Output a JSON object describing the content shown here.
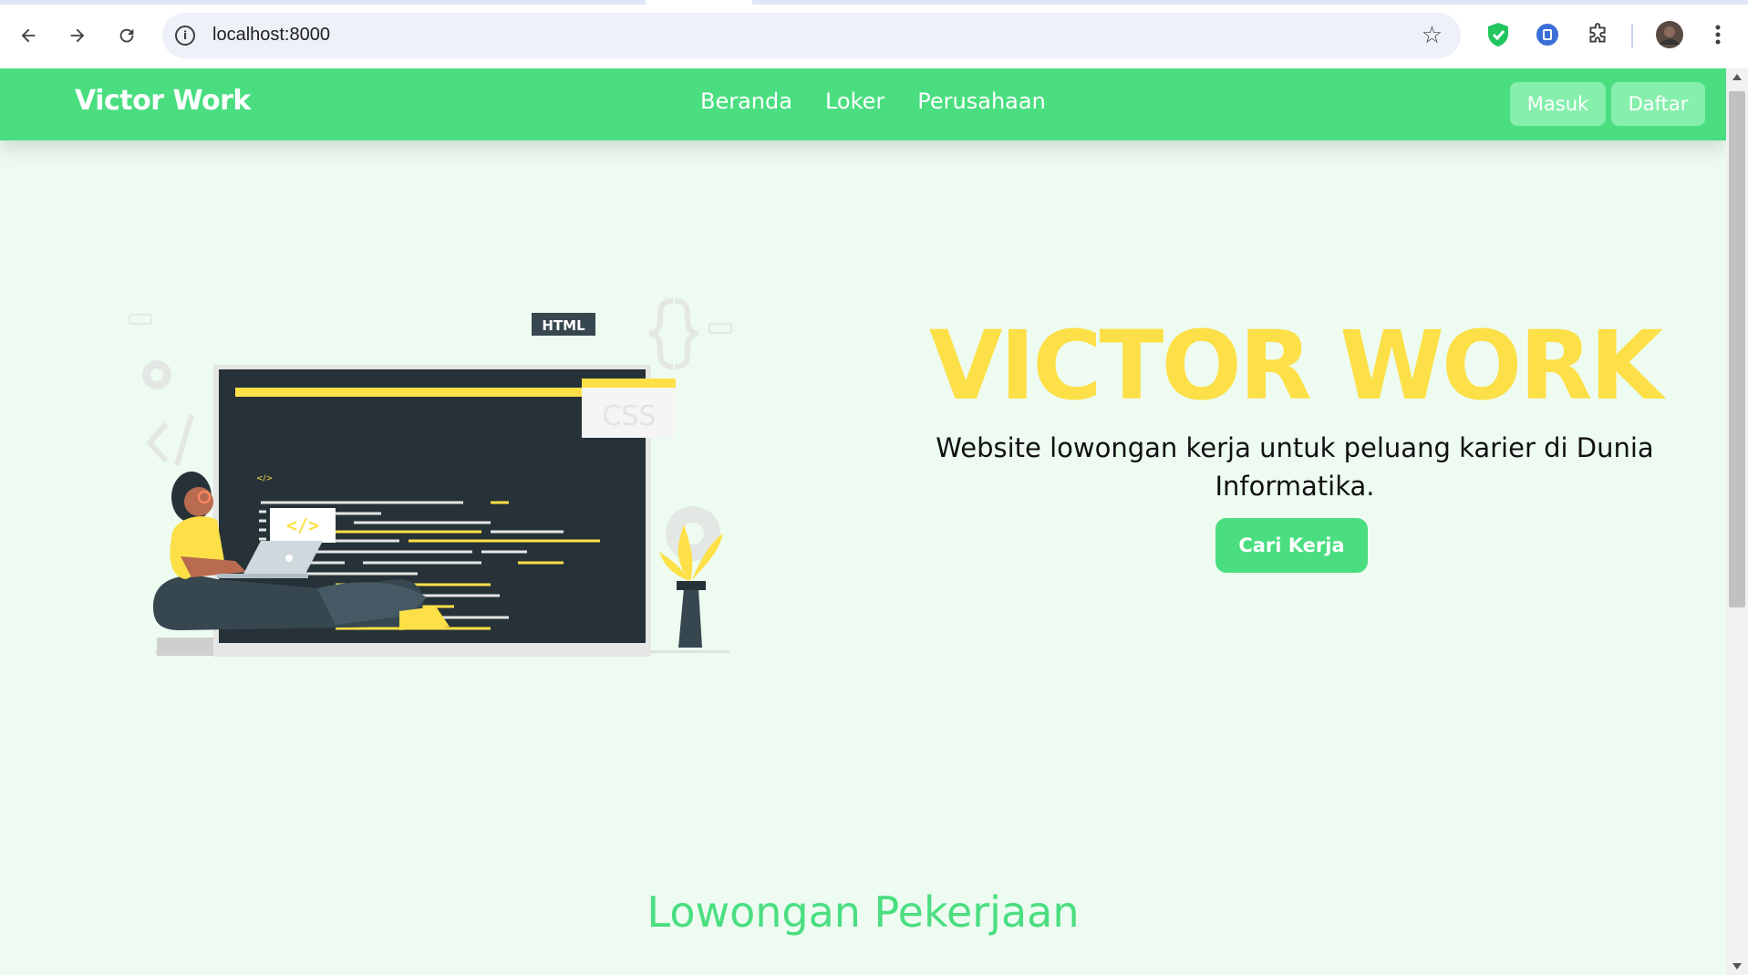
{
  "browser": {
    "url": "localhost:8000"
  },
  "navbar": {
    "brand": "Victor Work",
    "menu": [
      "Beranda",
      "Loker",
      "Perusahaan"
    ],
    "login_label": "Masuk",
    "register_label": "Daftar"
  },
  "hero": {
    "title": "VICTOR WORK",
    "description": "Website lowongan kerja untuk peluang karier di Dunia Informatika.",
    "cta_label": "Cari Kerja",
    "illustration_labels": {
      "html": "HTML",
      "css": "CSS"
    }
  },
  "section": {
    "title": "Lowongan Pekerjaan"
  },
  "colors": {
    "primary_green": "#4ade80",
    "light_green": "#86efac",
    "background": "#edfbf1",
    "accent_yellow": "#fde047"
  }
}
